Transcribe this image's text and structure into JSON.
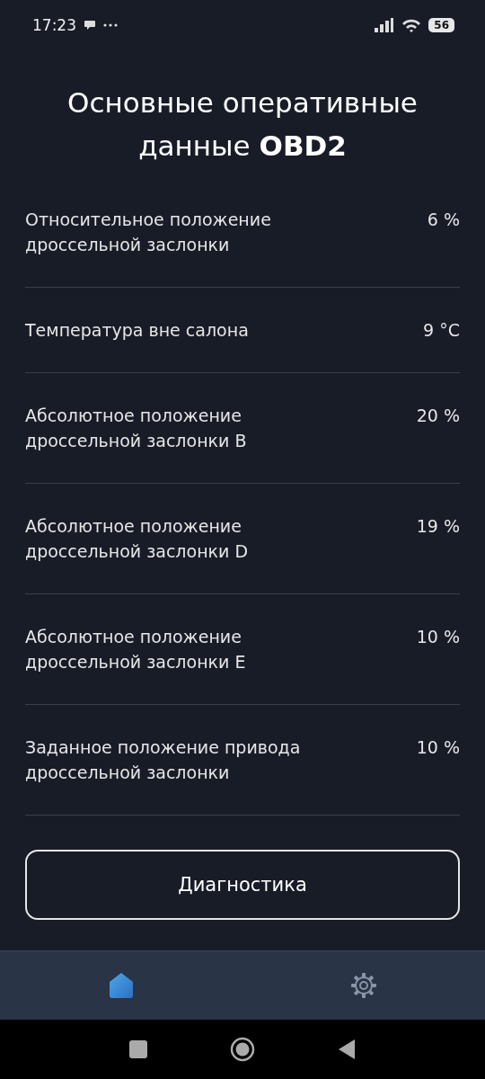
{
  "status_bar": {
    "time": "17:23",
    "battery": "56"
  },
  "title": "Основные оперативные данные **OBD2**",
  "rows": [
    {
      "label": "Относительное положение дроссельной заслонки",
      "value": "6 %"
    },
    {
      "label": "Температура вне салона",
      "value": "9 °C"
    },
    {
      "label": "Абсолютное положение дроссельной заслонки B",
      "value": "20 %"
    },
    {
      "label": "Абсолютное положение дроссельной заслонки D",
      "value": "19 %"
    },
    {
      "label": "Абсолютное положение дроссельной заслонки E",
      "value": "10 %"
    },
    {
      "label": "Заданное положение привода дроссельной заслонки",
      "value": "10 %"
    }
  ],
  "button": "Диагностика",
  "bottom_nav": [
    {
      "kind": "home",
      "selected": true
    },
    {
      "kind": "settings",
      "selected": false
    }
  ]
}
